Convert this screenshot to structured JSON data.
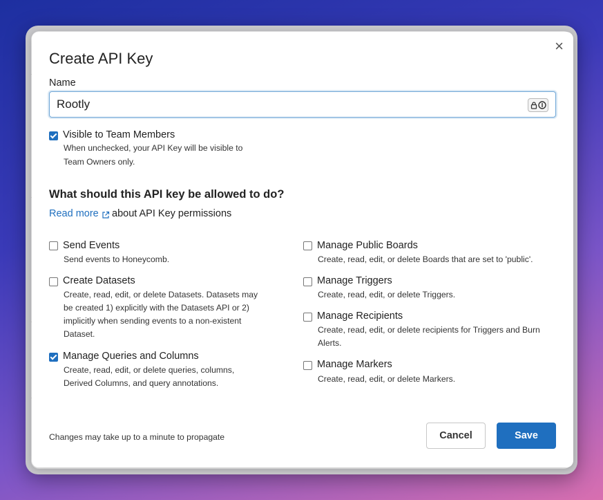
{
  "dialog": {
    "title": "Create API Key",
    "close_glyph": "×",
    "name_label": "Name",
    "name_value": "Rootly",
    "password_manager_icon": "lock-info-icon",
    "visible_label": "Visible to Team Members",
    "visible_checked": true,
    "visible_desc_line1": "When unchecked, your API Key will be visible to",
    "visible_desc_line2": "Team Owners only.",
    "permissions_heading": "What should this API key be allowed to do?",
    "read_more_link": "Read more",
    "read_more_rest": "about API Key permissions",
    "permissions_left": [
      {
        "label": "Send Events",
        "checked": false,
        "desc": [
          "Send events to Honeycomb."
        ]
      },
      {
        "label": "Create Datasets",
        "checked": false,
        "desc": [
          "Create, read, edit, or delete Datasets. Datasets may",
          "be created 1) explicitly with the Datasets API or 2)",
          "implicitly when sending events to a non-existent",
          "Dataset."
        ]
      },
      {
        "label": "Manage Queries and Columns",
        "checked": true,
        "desc": [
          "Create, read, edit, or delete queries, columns,",
          "Derived Columns, and query annotations."
        ]
      }
    ],
    "permissions_right": [
      {
        "label": "Manage Public Boards",
        "checked": false,
        "desc": [
          "Create, read, edit, or delete Boards that are set to 'public'."
        ]
      },
      {
        "label": "Manage Triggers",
        "checked": false,
        "desc": [
          "Create, read, edit, or delete Triggers."
        ]
      },
      {
        "label": "Manage Recipients",
        "checked": false,
        "desc": [
          "Create, read, edit, or delete recipients for Triggers and Burn",
          "Alerts."
        ]
      },
      {
        "label": "Manage Markers",
        "checked": false,
        "desc": [
          "Create, read, edit, or delete Markers."
        ]
      }
    ],
    "footer_note": "Changes may take up to a minute to propagate",
    "cancel_label": "Cancel",
    "save_label": "Save"
  },
  "colors": {
    "accent": "#1f6fbf",
    "background_gradient": [
      "#1d2fa0",
      "#d86fb0"
    ]
  }
}
